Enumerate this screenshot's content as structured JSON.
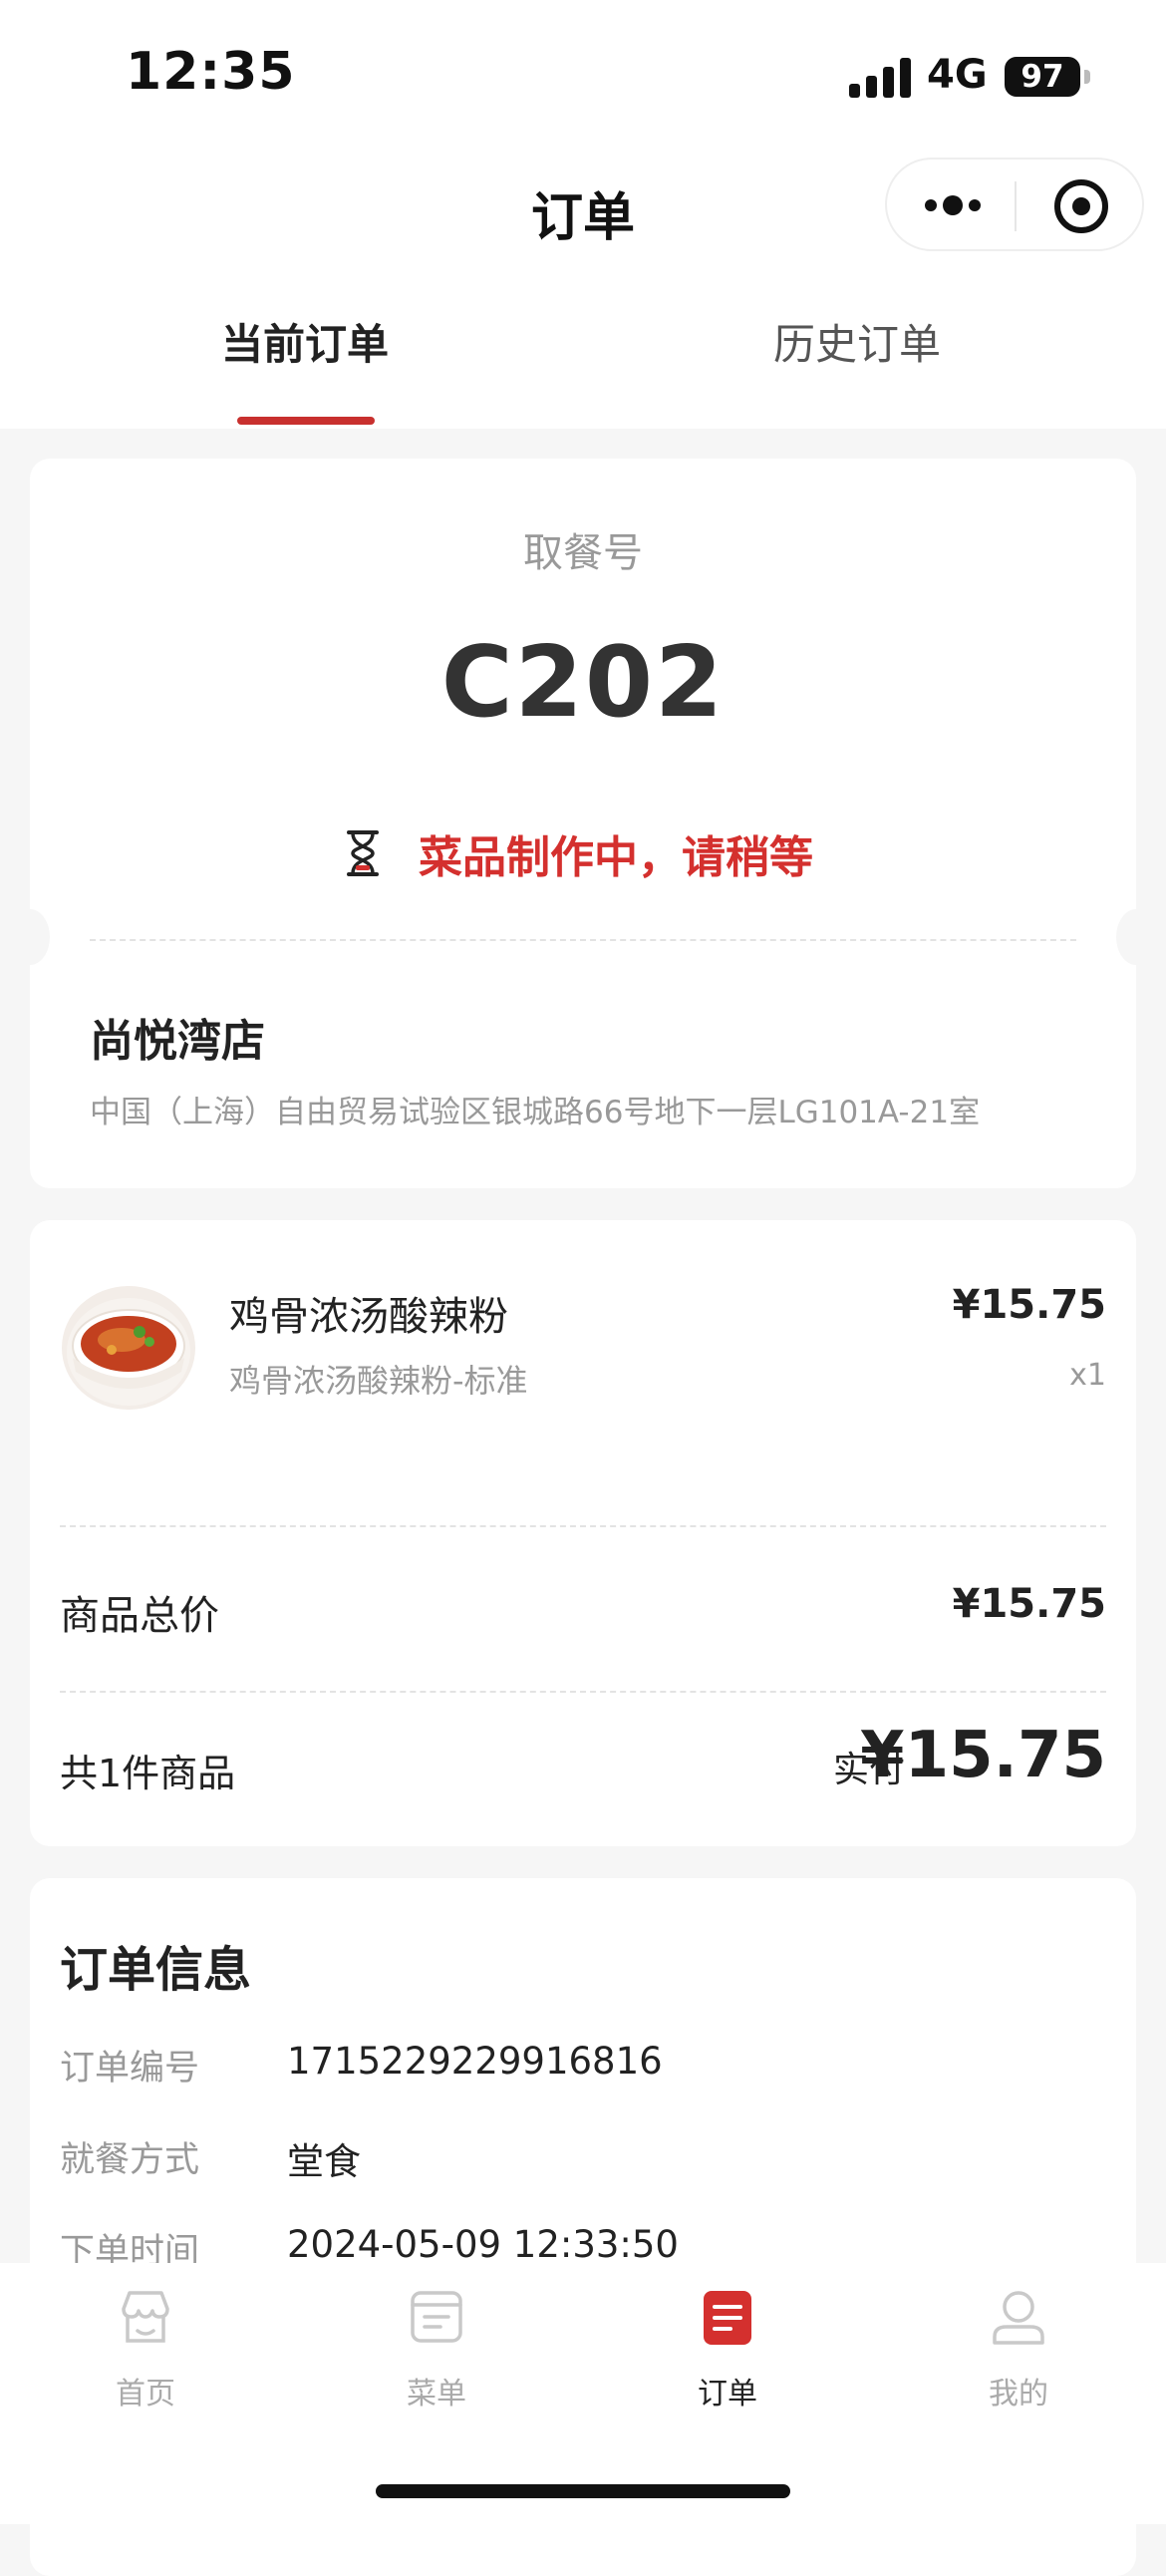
{
  "status_bar": {
    "time": "12:35",
    "network": "4G",
    "battery": "97"
  },
  "nav": {
    "title": "订单"
  },
  "tabs": [
    {
      "label": "当前订单",
      "active": true
    },
    {
      "label": "历史订单",
      "active": false
    }
  ],
  "pickup": {
    "label": "取餐号",
    "number": "C202",
    "status": "菜品制作中，请稍等",
    "status_color": "#d4302e"
  },
  "store": {
    "name": "尚悦湾店",
    "address": "中国（上海）自由贸易试验区银城路66号地下一层LG101A-21室"
  },
  "item": {
    "name": "鸡骨浓汤酸辣粉",
    "spec": "鸡骨浓汤酸辣粉-标准",
    "price": "¥15.75",
    "qty": "x1"
  },
  "summary": {
    "subtotal_label": "商品总价",
    "subtotal_value": "¥15.75",
    "count_label": "共1件商品",
    "paid_label": "实付",
    "paid_value": "¥15.75"
  },
  "order_info": {
    "title": "订单信息",
    "rows": [
      {
        "label": "订单编号",
        "value": "1715229229916816"
      },
      {
        "label": "就餐方式",
        "value": "堂食"
      },
      {
        "label": "下单时间",
        "value": "2024-05-09 12:33:50"
      }
    ]
  },
  "tabbar": {
    "items": [
      {
        "label": "首页",
        "icon": "home-icon"
      },
      {
        "label": "菜单",
        "icon": "menu-icon"
      },
      {
        "label": "订单",
        "icon": "order-icon",
        "active": true
      },
      {
        "label": "我的",
        "icon": "profile-icon"
      }
    ],
    "active_color": "#d4302e"
  }
}
